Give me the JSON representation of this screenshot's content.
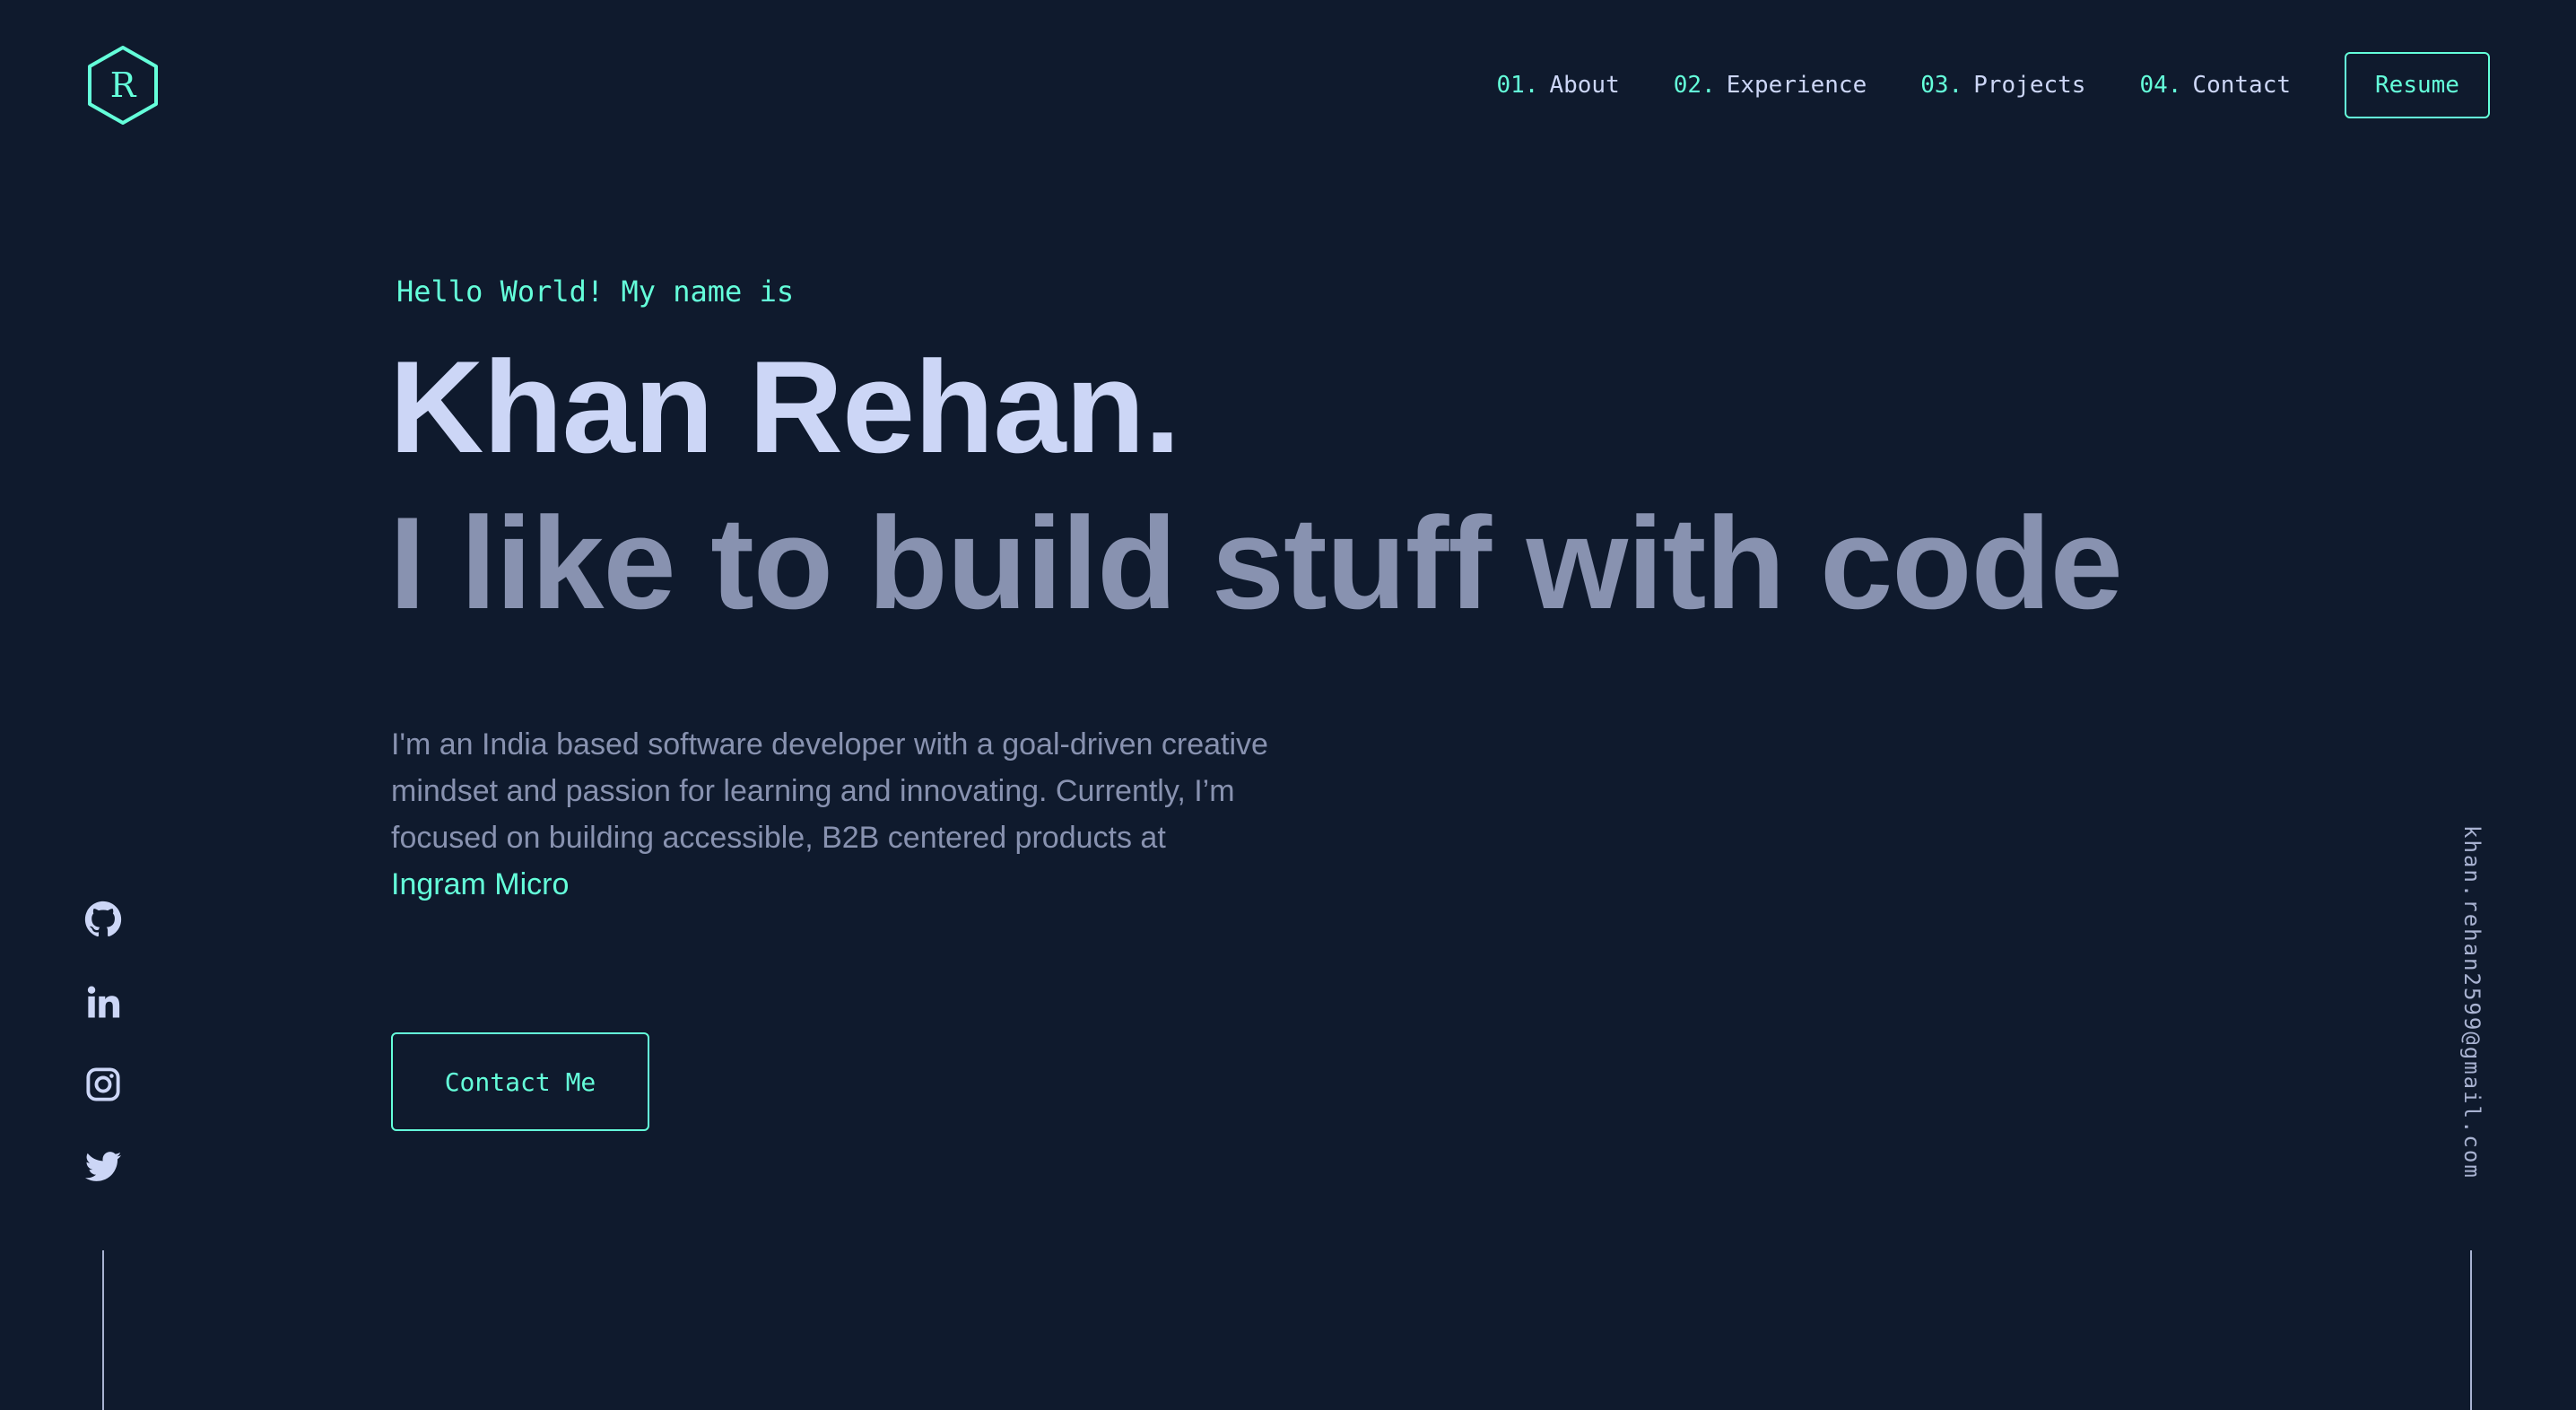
{
  "header": {
    "logo_letter": "R",
    "nav": [
      {
        "num": "01.",
        "label": "About"
      },
      {
        "num": "02.",
        "label": "Experience"
      },
      {
        "num": "03.",
        "label": "Projects"
      },
      {
        "num": "04.",
        "label": "Contact"
      }
    ],
    "resume_label": "Resume"
  },
  "hero": {
    "greeting": "Hello World! My name is",
    "name": "Khan Rehan.",
    "tagline": "I like to build stuff with code",
    "bio_text": "I'm an India based software developer with a goal-driven creative mindset and passion for learning and innovating. Currently, I’m focused on building accessible, B2B centered products at",
    "bio_link": "Ingram Micro",
    "contact_label": "Contact Me"
  },
  "social": {
    "icons": [
      "github-icon",
      "linkedin-icon",
      "instagram-icon",
      "twitter-icon"
    ]
  },
  "email": "khan.rehan2599@gmail.com",
  "colors": {
    "background": "#0f1a2d",
    "accent": "#64ffda",
    "heading": "#ccd6f6",
    "muted": "#8892b0"
  }
}
